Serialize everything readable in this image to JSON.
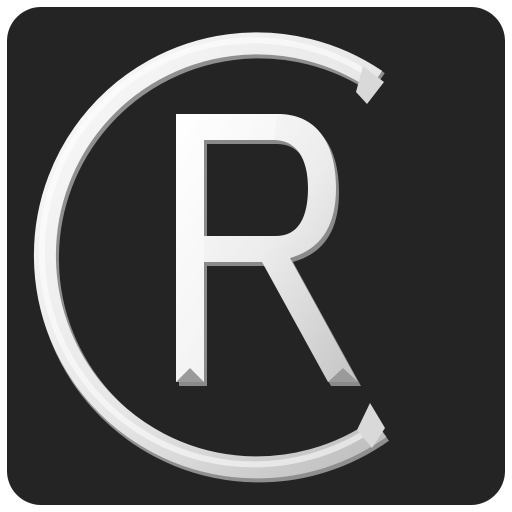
{
  "app_icon": {
    "icon": "cr-monogram-icon",
    "colors": {
      "tile_background": "#242424",
      "page_background": "#ffffff",
      "emblem_light": "#f7f7f7",
      "emblem_mid": "#cfcfcf",
      "emblem_shadow": "#8f8f8f"
    }
  }
}
